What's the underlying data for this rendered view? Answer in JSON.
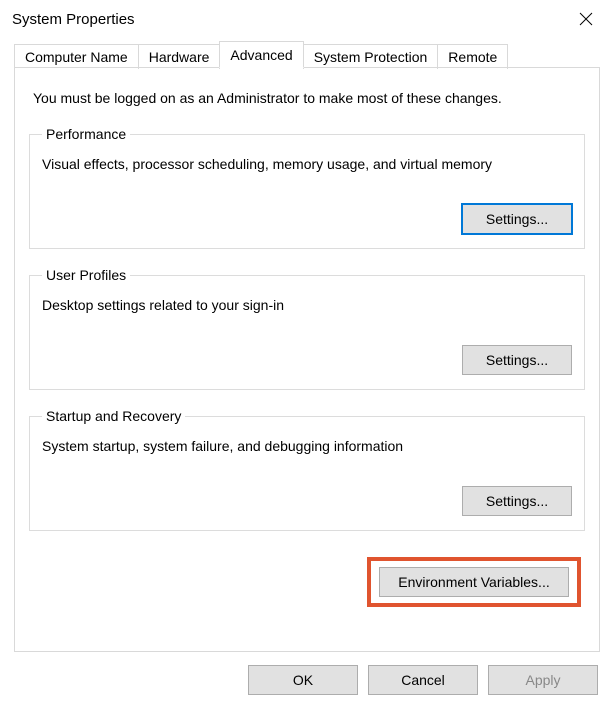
{
  "window": {
    "title": "System Properties"
  },
  "tabs": {
    "computer_name": "Computer Name",
    "hardware": "Hardware",
    "advanced": "Advanced",
    "system_protection": "System Protection",
    "remote": "Remote"
  },
  "intro": "You must be logged on as an Administrator to make most of these changes.",
  "performance": {
    "legend": "Performance",
    "desc": "Visual effects, processor scheduling, memory usage, and virtual memory",
    "settings_label": "Settings..."
  },
  "user_profiles": {
    "legend": "User Profiles",
    "desc": "Desktop settings related to your sign-in",
    "settings_label": "Settings..."
  },
  "startup_recovery": {
    "legend": "Startup and Recovery",
    "desc": "System startup, system failure, and debugging information",
    "settings_label": "Settings..."
  },
  "env_vars": {
    "label": "Environment Variables..."
  },
  "footer": {
    "ok": "OK",
    "cancel": "Cancel",
    "apply": "Apply"
  },
  "colors": {
    "highlight": "#e0542f",
    "focus": "#0078d7"
  }
}
